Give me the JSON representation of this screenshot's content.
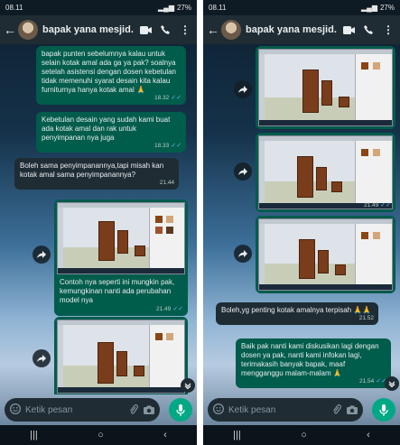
{
  "left": {
    "status": {
      "time": "08.11",
      "battery": "27%"
    },
    "contact_name": "bapak yana mesjid...",
    "messages": [
      {
        "text": "bapak punten sebelumnya kalau untuk selain kotak amal ada ga ya pak? soalnya setelah asistensi dengan dosen kebetulan tidak memenuhi syarat desain kita kalau furniturnya hanya kotak amal 🙏",
        "time": "18.32"
      },
      {
        "text": "Kebetulan desain yang sudah kami buat ada kotak amal dan rak untuk penyimpanan nya juga",
        "time": "18.33"
      },
      {
        "text": "Boleh sama penyimpanannya,tapi misah kan kotak amal sama penyimpanannya?",
        "time": "21.44"
      },
      {
        "text": "Contoh nya seperti ini mungkin pak, kemungkinan nanti ada perubahan model nya",
        "time": "21.49"
      }
    ],
    "input_placeholder": "Ketik pesan"
  },
  "right": {
    "status": {
      "time": "08.11",
      "battery": "27%"
    },
    "contact_name": "bapak yana mesjid...",
    "messages": [
      {
        "time": "21.49"
      },
      {
        "text": "Boleh,yg penting kotak amalnya terpisah 🙏🙏",
        "time": "21.52"
      },
      {
        "text": "Baik pak nanti kami diskusikan lagi dengan dosen ya pak, nanti kami infokan lagi, terimakasih banyak bapak, maaf mengganggu malam-malam 🙏",
        "time": "21.54"
      }
    ],
    "input_placeholder": "Ketik pesan"
  },
  "colors": {
    "outgoing": "#005c4b",
    "incoming": "#1f2c34",
    "header": "#1f2c34",
    "accent": "#00a884",
    "read_tick": "#53bdeb"
  }
}
